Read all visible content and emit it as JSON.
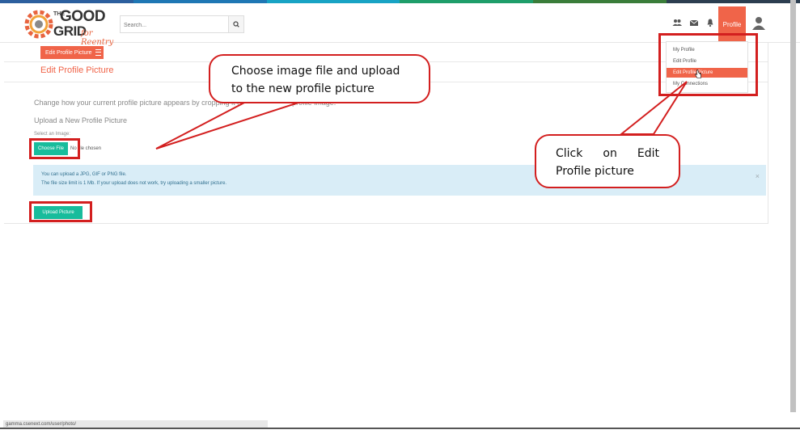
{
  "colors": {
    "accent": "#f06449",
    "primary": "#18bc9c",
    "info_bg": "#d9edf7",
    "annotation": "#d31f1f",
    "stripe": [
      "#2c5f9e",
      "#1f77b4",
      "#18a3c4",
      "#1e9e6a",
      "#3a7d3a",
      "#2c3e50"
    ]
  },
  "logo": {
    "the": "THE",
    "good": "GOOD",
    "grid": "GRID",
    "for": "for Reentry"
  },
  "navbar": {
    "search_placeholder": "Search...",
    "search_icon": "search-icon",
    "icons": [
      "users-icon",
      "envelope-icon",
      "bell-icon"
    ],
    "profile_label": "Profile",
    "avatar_icon": "user-icon"
  },
  "dropdown": {
    "items": [
      {
        "label": "My Profile",
        "active": false
      },
      {
        "label": "Edit Profile",
        "active": false
      },
      {
        "label": "Edit Profile Picture",
        "active": true
      },
      {
        "label": "My Connections",
        "active": false
      }
    ]
  },
  "main": {
    "edit_button_label": "Edit Profile Picture",
    "page_title": "Edit Profile Picture",
    "description": "Change how your current profile picture appears by cropping it or Upload a new profile image.",
    "section_title": "Upload a New Profile Picture",
    "select_label": "Select an Image:",
    "choose_file_label": "Choose File",
    "no_file_text": "No file chosen",
    "info_line1": "You can upload a JPG, GIF or PNG file.",
    "info_line2": "The file size limit is 1 Mb. If your upload does not work, try uploading a smaller picture.",
    "info_close": "×",
    "upload_button_label": "Upload Picture"
  },
  "status_bar": {
    "url": "gamma.csenext.com/user/photo/"
  },
  "annotations": {
    "callout1": "Choose image file and upload to the new profile picture",
    "callout2_line1": [
      "Click",
      "on",
      "Edit"
    ],
    "callout2_line2": "Profile picture"
  }
}
